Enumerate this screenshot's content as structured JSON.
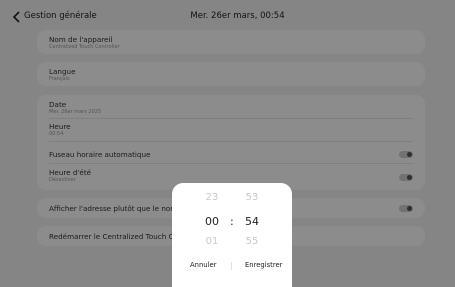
{
  "header": {
    "back_icon": "chevron-left-icon",
    "title": "Gestion générale",
    "clock": "Mer. 26er mars, 00:54"
  },
  "settings": {
    "device_name": {
      "label": "Nom de l'appareil",
      "value": "Centralized Touch Controller"
    },
    "language": {
      "label": "Langue",
      "value": "Français"
    },
    "date": {
      "label": "Date",
      "value": "Mer. 26er mars 2025"
    },
    "time": {
      "label": "Heure",
      "value": "00:54"
    },
    "auto_timezone": {
      "label": "Fuseau horaire automatique",
      "enabled": false
    },
    "dst": {
      "label": "Heure d'été",
      "value": "Désactiver",
      "enabled": false
    },
    "show_address": {
      "label": "Afficher l'adresse plutôt que le nom de l",
      "enabled": false
    },
    "restart": {
      "label": "Redémarrer le Centralized Touch Contro"
    }
  },
  "time_picker": {
    "hours": {
      "prev": "23",
      "current": "00",
      "next": "01"
    },
    "separator": ":",
    "minutes": {
      "prev": "53",
      "current": "54",
      "next": "55"
    },
    "cancel_label": "Annuler",
    "save_label": "Enregistrer"
  }
}
